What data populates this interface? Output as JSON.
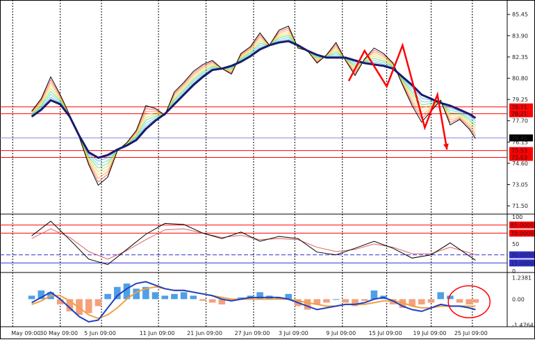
{
  "chart_data": [
    {
      "panel": "price",
      "type": "line",
      "ylim": [
        71.0,
        86.5
      ],
      "y_ticks": [
        "85.45",
        "83.90",
        "82.35",
        "80.80",
        "79.25",
        "77.70",
        "76.15",
        "74.60",
        "73.05",
        "71.50"
      ],
      "current_price": "76.45",
      "x": [
        0,
        3,
        6,
        9,
        12,
        15,
        18,
        21,
        24,
        27,
        30,
        33,
        36,
        39,
        42,
        45,
        48,
        51,
        54,
        57,
        60,
        63,
        66,
        69,
        72,
        75,
        78,
        81,
        84,
        87,
        90,
        93,
        96,
        99,
        102,
        105,
        108,
        111,
        114,
        117,
        120,
        123,
        126,
        129,
        132,
        135,
        138,
        140
      ],
      "series": [
        {
          "values": [
            78.4,
            79.3,
            80.9,
            79.6,
            78.1,
            76.5,
            74.5,
            73.0,
            73.6,
            75.5,
            76.1,
            77.0,
            78.8,
            78.6,
            78.1,
            79.8,
            80.5,
            81.3,
            81.8,
            82.1,
            81.5,
            81.1,
            82.6,
            83.1,
            84.1,
            83.2,
            84.3,
            84.6,
            83.0,
            82.8,
            81.9,
            82.5,
            83.4,
            82.1,
            81.0,
            82.2,
            83.0,
            82.6,
            81.9,
            80.3,
            78.8,
            77.6,
            78.4,
            79.2,
            77.4,
            77.8,
            77.1,
            76.4
          ]
        },
        {
          "values": [
            78.0,
            78.5,
            79.2,
            78.9,
            78.0,
            76.6,
            75.4,
            75.0,
            75.2,
            75.6,
            75.9,
            76.3,
            77.1,
            77.7,
            78.2,
            78.9,
            79.6,
            80.3,
            80.9,
            81.4,
            81.5,
            81.7,
            82.0,
            82.4,
            82.9,
            83.2,
            83.4,
            83.5,
            83.2,
            82.8,
            82.5,
            82.3,
            82.3,
            82.3,
            82.1,
            81.9,
            81.8,
            81.7,
            81.5,
            80.9,
            80.3,
            79.6,
            79.3,
            79.0,
            78.8,
            78.5,
            78.2,
            77.9
          ]
        }
      ],
      "horizontal_levels": [
        {
          "value": 78.71,
          "label": "78.71"
        },
        {
          "value": 78.21,
          "label": "78.21"
        },
        {
          "value": 75.53,
          "label": "75.53"
        },
        {
          "value": 75.03,
          "label": "75.03"
        }
      ]
    },
    {
      "panel": "oscillator",
      "type": "line",
      "ylim": [
        0,
        100
      ],
      "y_ticks": [
        "100",
        "50",
        "0"
      ],
      "levels": [
        {
          "value": 85,
          "label": "85.0000"
        },
        {
          "value": 70,
          "label": "70.0000"
        },
        {
          "value": 30,
          "label": "30.0000"
        },
        {
          "value": 15,
          "label": "15.0000"
        }
      ],
      "x": [
        0,
        6,
        12,
        18,
        24,
        30,
        36,
        42,
        48,
        54,
        60,
        66,
        72,
        78,
        84,
        90,
        96,
        102,
        108,
        114,
        120,
        126,
        132,
        138,
        140
      ],
      "series": [
        {
          "values": [
            65,
            92,
            58,
            22,
            12,
            40,
            68,
            88,
            86,
            70,
            60,
            72,
            55,
            64,
            60,
            35,
            30,
            42,
            55,
            42,
            24,
            30,
            52,
            28,
            20
          ]
        },
        {
          "values": [
            60,
            78,
            62,
            36,
            22,
            38,
            58,
            76,
            78,
            70,
            62,
            66,
            58,
            60,
            58,
            44,
            36,
            40,
            50,
            44,
            32,
            32,
            44,
            34,
            30
          ]
        }
      ]
    },
    {
      "panel": "macd",
      "type": "bar",
      "ylim": [
        -1.5,
        1.45
      ],
      "y_ticks": [
        "1.2381",
        "0.00",
        "-1.4764"
      ],
      "x": [
        0,
        3,
        6,
        9,
        12,
        15,
        18,
        21,
        24,
        27,
        30,
        33,
        36,
        39,
        42,
        45,
        48,
        51,
        54,
        57,
        60,
        63,
        66,
        69,
        72,
        75,
        78,
        81,
        84,
        87,
        90,
        93,
        96,
        99,
        102,
        105,
        108,
        111,
        114,
        117,
        120,
        123,
        126,
        129,
        132,
        135,
        138,
        140
      ],
      "values": [
        0.2,
        0.5,
        0.4,
        -0.3,
        -0.7,
        -0.9,
        -0.8,
        -0.4,
        0.3,
        0.7,
        0.9,
        0.6,
        0.7,
        0.4,
        0.2,
        0.3,
        0.4,
        0.2,
        -0.1,
        -0.2,
        -0.3,
        -0.1,
        0.1,
        0.2,
        0.4,
        0.2,
        0.1,
        0.3,
        -0.4,
        -0.6,
        -0.3,
        -0.2,
        0.0,
        -0.2,
        -0.4,
        -0.1,
        0.5,
        0.2,
        -0.3,
        -0.5,
        -0.4,
        -0.3,
        -0.2,
        0.4,
        0.2,
        -0.2,
        -0.3,
        -0.2
      ],
      "series": [
        {
          "values": [
            -0.2,
            0.1,
            0.4,
            0.0,
            -0.5,
            -1.0,
            -1.3,
            -1.2,
            -0.5,
            0.2,
            0.6,
            0.9,
            1.0,
            0.8,
            0.6,
            0.5,
            0.5,
            0.4,
            0.3,
            0.2,
            0.0,
            -0.1,
            0.0,
            0.1,
            0.1,
            0.1,
            0.1,
            0.0,
            -0.2,
            -0.4,
            -0.6,
            -0.5,
            -0.4,
            -0.3,
            -0.3,
            -0.2,
            0.0,
            0.1,
            -0.1,
            -0.4,
            -0.6,
            -0.7,
            -0.5,
            -0.3,
            -0.4,
            -0.4,
            -0.5,
            -0.6
          ]
        },
        {
          "values": [
            -0.3,
            -0.1,
            0.2,
            0.2,
            -0.1,
            -0.5,
            -0.9,
            -1.1,
            -0.9,
            -0.5,
            0.0,
            0.4,
            0.6,
            0.7,
            0.6,
            0.5,
            0.5,
            0.4,
            0.3,
            0.2,
            0.1,
            0.0,
            0.0,
            0.0,
            0.0,
            0.0,
            0.0,
            0.0,
            -0.1,
            -0.2,
            -0.3,
            -0.4,
            -0.4,
            -0.3,
            -0.3,
            -0.3,
            -0.2,
            -0.1,
            -0.1,
            -0.2,
            -0.4,
            -0.5,
            -0.5,
            -0.4,
            -0.4,
            -0.4,
            -0.4,
            -0.4
          ]
        }
      ]
    }
  ],
  "x_axis": {
    "range": [
      -10,
      150
    ],
    "labels": [
      {
        "x": -6,
        "label": "May 09:00"
      },
      {
        "x": 9,
        "label": "30 May 09:00"
      },
      {
        "x": 22,
        "label": "5 Jun 09:00"
      },
      {
        "x": 40,
        "label": "11 Jun 09:00"
      },
      {
        "x": 55,
        "label": "21 Jun 09:00"
      },
      {
        "x": 70,
        "label": "27 Jun 09:00"
      },
      {
        "x": 83,
        "label": "3 Jul 09:00"
      },
      {
        "x": 98,
        "label": "9 Jul 09:00"
      },
      {
        "x": 112,
        "label": "15 Jul 09:00"
      },
      {
        "x": 126,
        "label": "19 Jul 09:00"
      },
      {
        "x": 139,
        "label": "25 Jul 09:00"
      }
    ]
  },
  "colors": {
    "price_line": "#000000",
    "moving_average": "#1a1a6e",
    "level_line": "#ff0000",
    "current_line": "#8a8ae0",
    "osc_fast": "#000000",
    "osc_slow": "#e06060",
    "macd_line": "#1f3fbf",
    "signal_line": "#f0a040",
    "hist_pos": "#4f9fe6",
    "hist_neg": "#f4a07a",
    "annotation": "#ff0000"
  }
}
